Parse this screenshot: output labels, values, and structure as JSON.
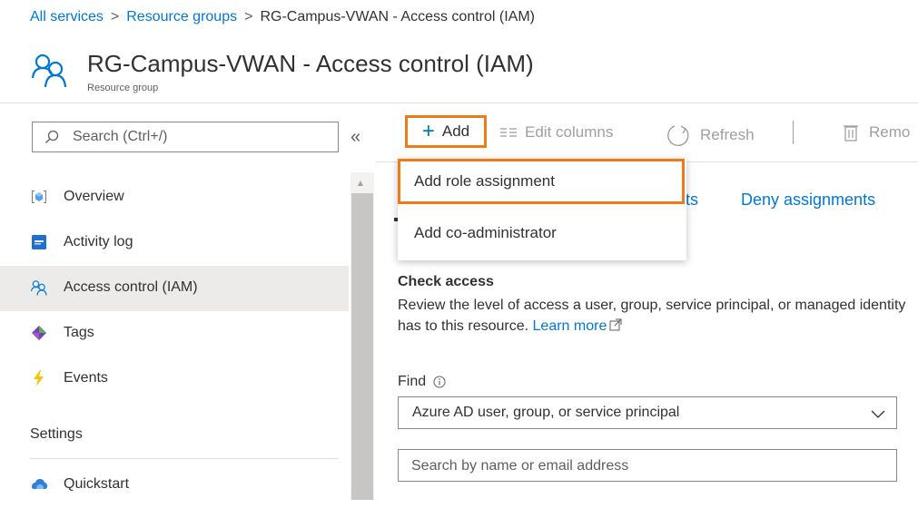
{
  "breadcrumb": {
    "items": [
      "All services",
      "Resource groups",
      "RG-Campus-VWAN - Access control (IAM)"
    ],
    "separator": ">"
  },
  "header": {
    "title": "RG-Campus-VWAN - Access control (IAM)",
    "subtitle": "Resource group",
    "icon": "access-control-icon"
  },
  "sidebar": {
    "search_placeholder": "Search (Ctrl+/)",
    "collapse_glyph": "«",
    "items": [
      {
        "label": "Overview",
        "icon": "overview-icon",
        "selected": false
      },
      {
        "label": "Activity log",
        "icon": "activity-log-icon",
        "selected": false
      },
      {
        "label": "Access control (IAM)",
        "icon": "access-control-icon",
        "selected": true
      },
      {
        "label": "Tags",
        "icon": "tag-icon",
        "selected": false
      },
      {
        "label": "Events",
        "icon": "events-bolt-icon",
        "selected": false
      }
    ],
    "section_heading": "Settings",
    "section_items": [
      {
        "label": "Quickstart",
        "icon": "quickstart-icon"
      }
    ]
  },
  "toolbar": {
    "add_label": "Add",
    "edit_columns_label": "Edit columns",
    "refresh_label": "Refresh",
    "remove_label": "Remo"
  },
  "tabs": {
    "partial_label": "nts",
    "deny_label": "Deny assignments"
  },
  "dropdown": {
    "items": [
      "Add role assignment",
      "Add co-administrator"
    ]
  },
  "check_access": {
    "title": "Check access",
    "description": "Review the level of access a user, group, service principal, or managed identity has to this resource.",
    "learn_more": "Learn more",
    "find_label": "Find",
    "find_value": "Azure AD user, group, or service principal",
    "search_placeholder": "Search by name or email address"
  },
  "colors": {
    "accent": "#0078d4",
    "highlight": "#ef7b16",
    "selected_bg": "#edebe9"
  }
}
